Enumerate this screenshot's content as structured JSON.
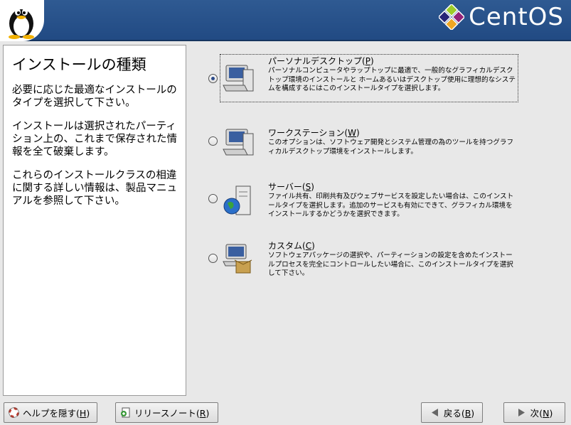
{
  "header": {
    "brand": "CentOS"
  },
  "help": {
    "title": "インストールの種類",
    "paragraphs": [
      "必要に応じた最適なインストールのタイプを選択して下さい。",
      "インストールは選択されたパーティション上の、これまで保存された情報を全て破棄します。",
      "これらのインストールクラスの相違に関する詳しい情報は、製品マニュアルを参照して下さい。"
    ]
  },
  "options": [
    {
      "label": "パーソナルデスクトップ",
      "mnemonic": "P",
      "selected": true,
      "icon": "desktop-computer-icon",
      "description": "パーソナルコンピュータやラップトップに最適で、一般的なグラフィカルデスクトップ環境のインストールと ホームあるいはデスクトップ使用に理想的なシステムを構成するにはこのインストールタイプを選択します。"
    },
    {
      "label": "ワークステーション",
      "mnemonic": "W",
      "selected": false,
      "icon": "workstation-computer-icon",
      "description": "このオプションは、ソフトウェア開発とシステム管理の為のツールを持つグラフィカルデスクトップ環境をインストールします。"
    },
    {
      "label": "サーバー",
      "mnemonic": "S",
      "selected": false,
      "icon": "server-globe-icon",
      "description": "ファイル共有、印刷共有及びウェブサービスを設定したい場合は、このインストールタイプを選択します。追加のサービスも有効にできて、グラフィカル環境を インストールするかどうかを選択できます。"
    },
    {
      "label": "カスタム",
      "mnemonic": "C",
      "selected": false,
      "icon": "custom-package-icon",
      "description": "ソフトウェアパッケージの選択や、パーティーションの設定を含めたインストールプロセスを完全にコントロールしたい場合に、このインストールタイプを選択して下さい。"
    }
  ],
  "buttons": {
    "hide_help": {
      "label": "ヘルプを隠す",
      "mnemonic": "H"
    },
    "release_notes": {
      "label": "リリースノート",
      "mnemonic": "R"
    },
    "back": {
      "label": "戻る",
      "mnemonic": "B"
    },
    "next": {
      "label": "次",
      "mnemonic": "N"
    }
  }
}
